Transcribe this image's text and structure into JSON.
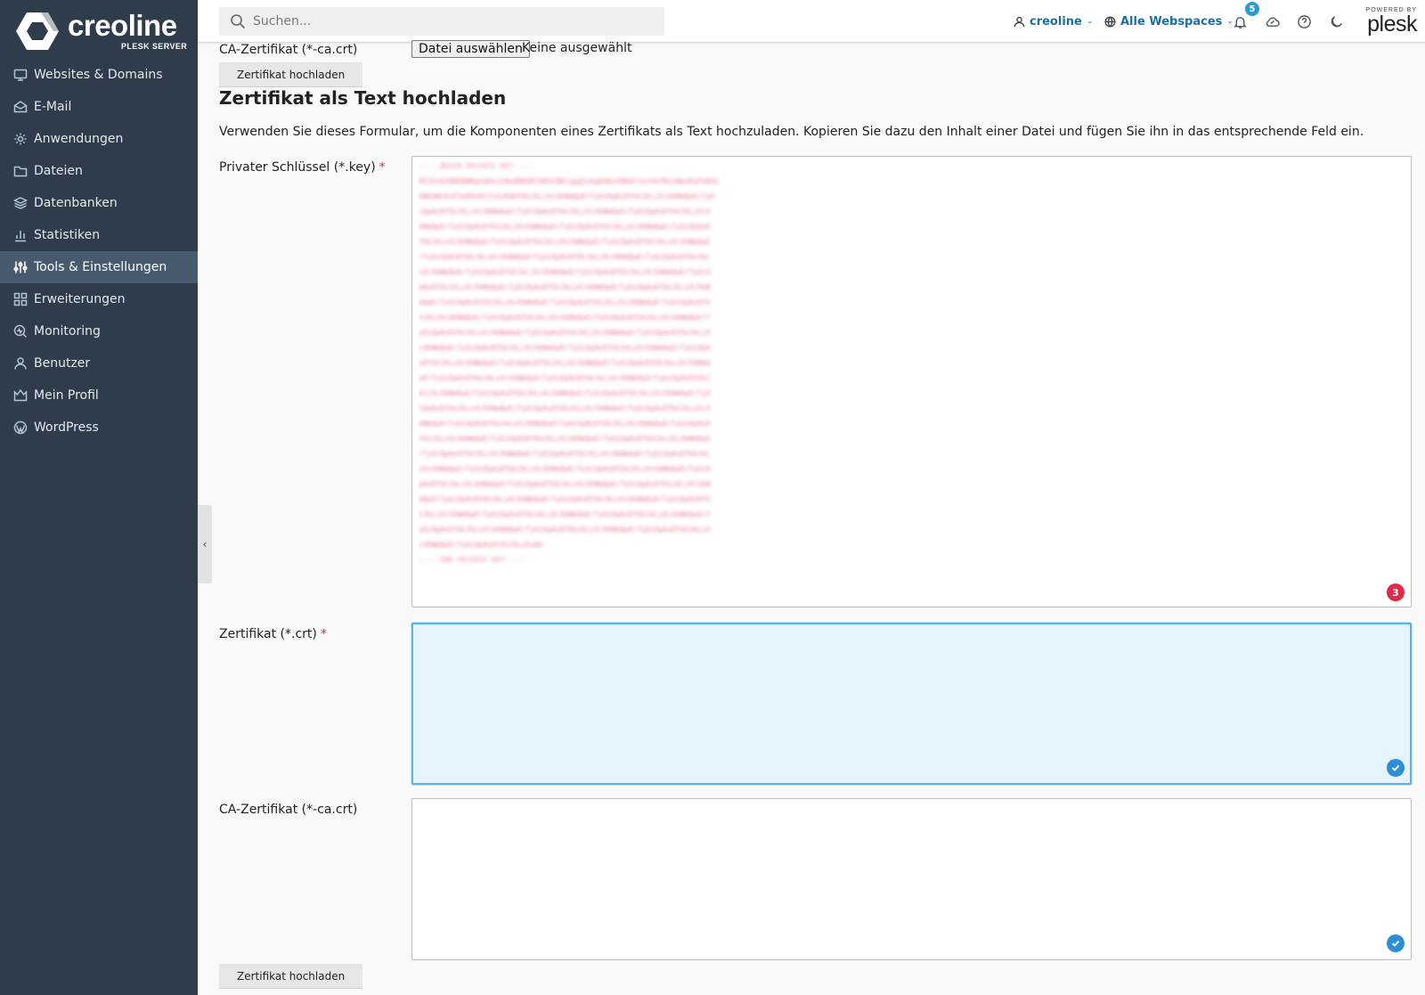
{
  "brand": {
    "name": "creoline",
    "subtitle": "PLESK SERVER",
    "powered_by": "POWERED BY",
    "product": "plesk"
  },
  "sidebar": {
    "items": [
      {
        "label": "Websites & Domains",
        "icon": "monitor-icon"
      },
      {
        "label": "E-Mail",
        "icon": "mail-icon"
      },
      {
        "label": "Anwendungen",
        "icon": "gear-icon"
      },
      {
        "label": "Dateien",
        "icon": "folder-icon"
      },
      {
        "label": "Datenbanken",
        "icon": "database-icon"
      },
      {
        "label": "Statistiken",
        "icon": "bar-chart-icon"
      },
      {
        "label": "Tools & Einstellungen",
        "icon": "sliders-icon",
        "active": true
      },
      {
        "label": "Erweiterungen",
        "icon": "extensions-icon"
      },
      {
        "label": "Monitoring",
        "icon": "monitoring-icon"
      },
      {
        "label": "Benutzer",
        "icon": "user-icon"
      },
      {
        "label": "Mein Profil",
        "icon": "profile-icon"
      },
      {
        "label": "WordPress",
        "icon": "wordpress-icon"
      }
    ],
    "collapse_glyph": "‹"
  },
  "header": {
    "search_placeholder": "Suchen...",
    "user": "creoline",
    "webspaces": "Alle Webspaces",
    "notifications_count": "5"
  },
  "upload_file": {
    "ca_label": "CA-Zertifikat (*-ca.crt)",
    "choose_file": "Datei auswählen",
    "no_file": "Keine ausgewählt",
    "upload_button": "Zertifikat hochladen"
  },
  "text_upload": {
    "title": "Zertifikat als Text hochladen",
    "description": "Verwenden Sie dieses Formular, um die Komponenten eines Zertifikats als Text hochzuladen. Kopieren Sie dazu den Inhalt einer Datei und fügen Sie ihn in das entsprechende Feld ein.",
    "private_key_label": "Privater Schlüssel (*.key)",
    "certificate_label": "Zertifikat (*.crt)",
    "ca_label": "CA-Zertifikat (*-ca.crt)",
    "required_mark": "*",
    "private_key_error_count": "3",
    "upload_button": "Zertifikat hochladen",
    "key_begin": "-----BEGIN PRIVATE KEY-----",
    "key_end": "-----END PRIVATE KEY-----",
    "key_lines": [
      "MIIEvQIBADANBgkqhkiG9w0BAQEFAASCBKcwggSjAgEAAoIBAQC1kJhGfR2zWp4XqTm8Vn",
      "bN6hWLKxP3eQ9sRtYuIoPaDfGhJkLzXcVbNmQwErTyUiOpAsDfGhJkLzXcVbNmQwErTyU",
      "iOpAsDfGhJkLzXcVbNmQwErTyUiOpAsDfGhJkLzXcVbNmQwErTyUiOpAsDfGhJkLzXcV",
      "bNmQwErTyUiOpAsDfGhJkLzXcVbNmQwErTyUiOpAsDfGhJkLzXcVbNmQwErTyUiOpAsD",
      "fGhJkLzXcVbNmQwErTyUiOpAsDfGhJkLzXcVbNmQwErTyUiOpAsDfGhJkLzXcVbNmQwE",
      "rTyUiOpAsDfGhJkLzXcVbNmQwErTyUiOpAsDfGhJkLzXcVbNmQwErTyUiOpAsDfGhJkL",
      "zXcVbNmQwErTyUiOpAsDfGhJkLzXcVbNmQwErTyUiOpAsDfGhJkLzXcVbNmQwErTyUiO",
      "pAsDfGhJkLzXcVbNmQwErTyUiOpAsDfGhJkLzXcVbNmQwErTyUiOpAsDfGhJkLzXcVbN",
      "mQwErTyUiOpAsDfGhJkLzXcVbNmQwErTyUiOpAsDfGhJkLzXcVbNmQwErTyUiOpAsDfG",
      "hJkLzXcVbNmQwErTyUiOpAsDfGhJkLzXcVbNmQwErTyUiOpAsDfGhJkLzXcVbNmQwErT",
      "yUiOpAsDfGhJkLzXcVbNmQwErTyUiOpAsDfGhJkLzXcVbNmQwErTyUiOpAsDfGhJkLzX",
      "cVbNmQwErTyUiOpAsDfGhJkLzXcVbNmQwErTyUiOpAsDfGhJkLzXcVbNmQwErTyUiOpA",
      "sDfGhJkLzXcVbNmQwErTyUiOpAsDfGhJkLzXcVbNmQwErTyUiOpAsDfGhJkLzXcVbNmQ",
      "wErTyUiOpAsDfGhJkLzXcVbNmQwErTyUiOpAsDfGhJkLzXcVbNmQwErTyUiOpAsDfGhJ",
      "kLzXcVbNmQwErTyUiOpAsDfGhJkLzXcVbNmQwErTyUiOpAsDfGhJkLzXcVbNmQwErTyU",
      "iOpAsDfGhJkLzXcVbNmQwErTyUiOpAsDfGhJkLzXcVbNmQwErTyUiOpAsDfGhJkLzXcV",
      "bNmQwErTyUiOpAsDfGhJkLzXcVbNmQwErTyUiOpAsDfGhJkLzXcVbNmQwErTyUiOpAsD",
      "fGhJkLzXcVbNmQwErTyUiOpAsDfGhJkLzXcVbNmQwErTyUiOpAsDfGhJkLzXcVbNmQwE",
      "rTyUiOpAsDfGhJkLzXcVbNmQwErTyUiOpAsDfGhJkLzXcVbNmQwErTyUiOpAsDfGhJkL",
      "zXcVbNmQwErTyUiOpAsDfGhJkLzXcVbNmQwErTyUiOpAsDfGhJkLzXcVbNmQwErTyUiO",
      "pAsDfGhJkLzXcVbNmQwErTyUiOpAsDfGhJkLzXcVbNmQwErTyUiOpAsDfGhJkLzXcVbN",
      "mQwErTyUiOpAsDfGhJkLzXcVbNmQwErTyUiOpAsDfGhJkLzXcVbNmQwErTyUiOpAsDfG",
      "hJkLzXcVbNmQwErTyUiOpAsDfGhJkLzXcVbNmQwErTyUiOpAsDfGhJkLzXcVbNmQwErT",
      "yUiOpAsDfGhJkLzXcVbNmQwErTyUiOpAsDfGhJkLzXcVbNmQwErTyUiOpAsDfGhJkLzX",
      "cVbNmQwErTyUiOpAsDfGhJkLz5uQk"
    ]
  },
  "colors": {
    "sidebar_bg": "#2f3c4b",
    "sidebar_active": "#485a6d",
    "link_blue": "#1b6fa7",
    "error_red": "#e0294a",
    "ok_blue": "#2a8fd4",
    "focus_bg": "#e4f3fc"
  }
}
